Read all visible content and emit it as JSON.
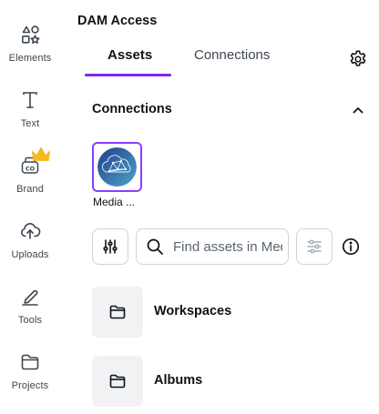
{
  "rail": {
    "items": [
      {
        "label": "Elements",
        "icon": "elements-icon"
      },
      {
        "label": "Text",
        "icon": "text-icon"
      },
      {
        "label": "Brand",
        "icon": "brand-icon",
        "badge_icon": "crown-icon"
      },
      {
        "label": "Uploads",
        "icon": "cloud-upload-icon"
      },
      {
        "label": "Tools",
        "icon": "tools-icon"
      },
      {
        "label": "Projects",
        "icon": "folder-icon"
      }
    ]
  },
  "panel": {
    "title": "DAM Access",
    "tabs": [
      {
        "label": "Assets",
        "active": true
      },
      {
        "label": "Connections",
        "active": false
      }
    ],
    "section_title": "Connections",
    "connection": {
      "label": "Media ..."
    },
    "search": {
      "placeholder": "Find assets in Media..."
    },
    "folders": [
      {
        "label": "Workspaces"
      },
      {
        "label": "Albums"
      }
    ]
  },
  "colors": {
    "accent": "#7d2ae8",
    "crown": "#f5b922",
    "tile_bg": "#f1f2f4",
    "logo_bg": "#3b6fb3"
  }
}
